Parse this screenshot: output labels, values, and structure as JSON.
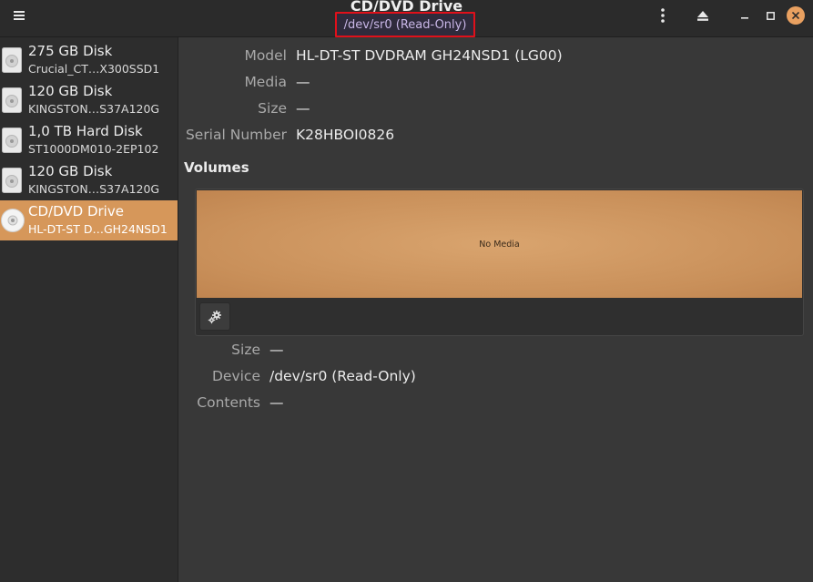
{
  "window": {
    "title": "CD/DVD Drive",
    "subtitle": "/dev/sr0 (Read-Only)"
  },
  "colors": {
    "accent": "#d6975a",
    "highlight_border": "#e0101a"
  },
  "icons": {
    "menu": "hamburger-menu-icon",
    "kebab": "vertical-dots-icon",
    "eject": "eject-icon",
    "minimize": "minimize-icon",
    "maximize": "maximize-icon",
    "close": "close-icon",
    "settings": "gears-icon"
  },
  "sidebar": {
    "items": [
      {
        "name": "275 GB Disk",
        "sub": "Crucial_CT…X300SSD1",
        "selected": false,
        "icon": "disk-icon"
      },
      {
        "name": "120 GB Disk",
        "sub": "KINGSTON…S37A120G",
        "selected": false,
        "icon": "disk-icon"
      },
      {
        "name": "1,0 TB Hard Disk",
        "sub": "ST1000DM010-2EP102",
        "selected": false,
        "icon": "disk-icon"
      },
      {
        "name": "120 GB Disk",
        "sub": "KINGSTON…S37A120G",
        "selected": false,
        "icon": "disk-icon"
      },
      {
        "name": "CD/DVD Drive",
        "sub": "HL-DT-ST D…GH24NSD1",
        "selected": true,
        "icon": "optical-disc-icon"
      }
    ]
  },
  "drive": {
    "model_label": "Model",
    "model": "HL-DT-ST DVDRAM GH24NSD1 (LG00)",
    "media_label": "Media",
    "media": "—",
    "size_label": "Size",
    "size": "—",
    "serial_label": "Serial Number",
    "serial": "K28HBOI0826"
  },
  "volumes": {
    "heading": "Volumes",
    "bar_text": "No Media",
    "size_label": "Size",
    "size": "—",
    "device_label": "Device",
    "device": "/dev/sr0 (Read-Only)",
    "contents_label": "Contents",
    "contents": "—"
  }
}
